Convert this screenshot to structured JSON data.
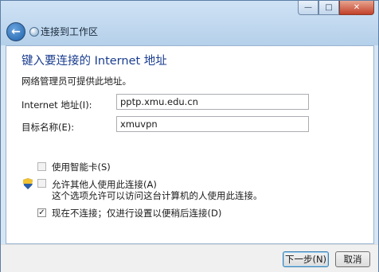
{
  "window": {
    "title": "连接到工作区",
    "controls": {
      "minimize": "—",
      "maximize": "□",
      "close": "✕"
    }
  },
  "nav": {
    "back_icon": "back-arrow-icon"
  },
  "main": {
    "heading": "键入要连接的 Internet 地址",
    "description": "网络管理员可提供此地址。",
    "internet_address_label": "Internet 地址(I):",
    "internet_address_value": "pptp.xmu.edu.cn",
    "destination_name_label": "目标名称(E):",
    "destination_name_value": "xmuvpn",
    "smartcard_label": "使用智能卡(S)",
    "allow_others_label": "允许其他人使用此连接(A)",
    "allow_others_hint": "这个选项允许可以访问这台计算机的人使用此连接。",
    "dont_connect_label": "现在不连接；仅进行设置以便稍后连接(D)",
    "dont_connect_checked": "✓"
  },
  "footer": {
    "next_label": "下一步(N)",
    "cancel_label": "取消"
  }
}
